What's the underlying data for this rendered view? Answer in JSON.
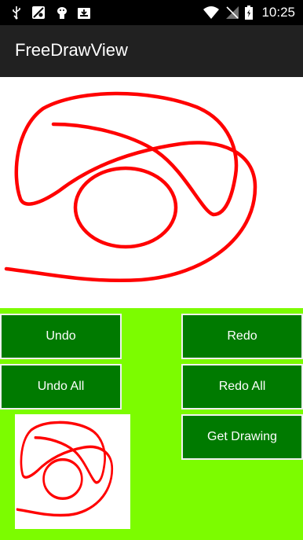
{
  "status_bar": {
    "time": "10:25",
    "icons": [
      "usb-icon",
      "maps-icon",
      "android-debug-icon",
      "inbox-download-icon",
      "wifi-icon",
      "no-sim-icon",
      "battery-icon"
    ]
  },
  "app_bar": {
    "title": "FreeDrawView"
  },
  "buttons": {
    "undo": "Undo",
    "redo": "Redo",
    "undo_all": "Undo All",
    "redo_all": "Redo All",
    "get_drawing": "Get Drawing"
  },
  "colors": {
    "stroke": "#ff0000",
    "panel_bg": "#7cfc00",
    "button_bg": "#007a00",
    "app_bar": "#212121"
  }
}
